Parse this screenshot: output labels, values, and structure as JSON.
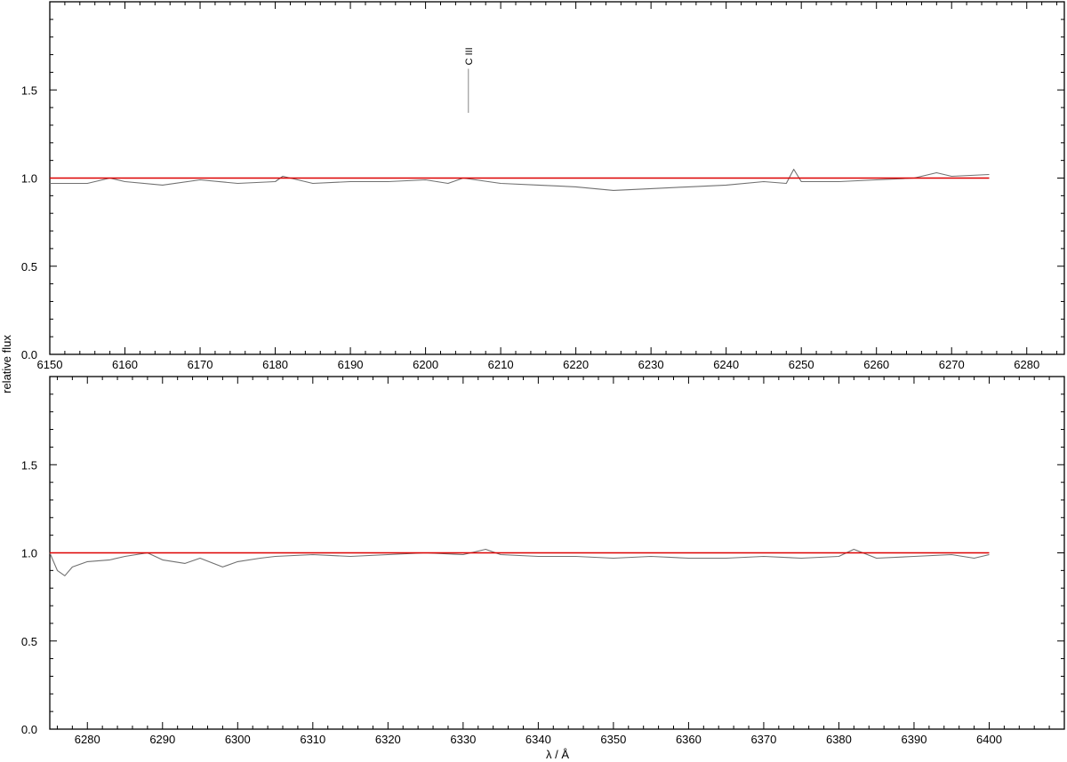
{
  "chart_data": {
    "type": "line",
    "ylabel": "relative flux",
    "xlabel": "λ / Å",
    "colors": {
      "observed": "#707070",
      "model": "#dd0000",
      "frame": "#000000"
    },
    "panels": [
      {
        "xlim": [
          6150,
          6285
        ],
        "ylim": [
          0.0,
          2.0
        ],
        "xticks": [
          6150,
          6160,
          6170,
          6180,
          6190,
          6200,
          6210,
          6220,
          6230,
          6240,
          6250,
          6260,
          6270,
          6280
        ],
        "yticks": [
          0.0,
          0.5,
          1.0,
          1.5
        ],
        "ytick_labels": [
          "0.0",
          "0.5",
          "1.0",
          "1.5"
        ],
        "annotations": [
          {
            "text": "C III",
            "x": 6205.7,
            "y_bottom": 1.37,
            "y_top": 1.62
          }
        ],
        "series": [
          {
            "role": "model",
            "x": [
              6150,
              6275
            ],
            "y": [
              1.0,
              1.0
            ]
          },
          {
            "role": "observed",
            "x": [
              6150,
              6155,
              6158,
              6160,
              6165,
              6170,
              6175,
              6180,
              6181,
              6185,
              6190,
              6195,
              6200,
              6203,
              6205,
              6210,
              6215,
              6220,
              6225,
              6230,
              6235,
              6240,
              6245,
              6248,
              6249,
              6250,
              6255,
              6260,
              6265,
              6268,
              6270,
              6275
            ],
            "y": [
              0.97,
              0.97,
              1.0,
              0.98,
              0.96,
              0.99,
              0.97,
              0.98,
              1.01,
              0.97,
              0.98,
              0.98,
              0.99,
              0.97,
              1.0,
              0.97,
              0.96,
              0.95,
              0.93,
              0.94,
              0.95,
              0.96,
              0.98,
              0.97,
              1.05,
              0.98,
              0.98,
              0.99,
              1.0,
              1.03,
              1.01,
              1.02
            ]
          }
        ]
      },
      {
        "xlim": [
          6275,
          6410
        ],
        "ylim": [
          0.0,
          2.0
        ],
        "xticks": [
          6280,
          6290,
          6300,
          6310,
          6320,
          6330,
          6340,
          6350,
          6360,
          6370,
          6380,
          6390,
          6400
        ],
        "yticks": [
          0.0,
          0.5,
          1.0,
          1.5
        ],
        "ytick_labels": [
          "0.0",
          "0.5",
          "1.0",
          "1.5"
        ],
        "annotations": [],
        "series": [
          {
            "role": "model",
            "x": [
              6275,
              6400
            ],
            "y": [
              1.0,
              1.0
            ]
          },
          {
            "role": "observed",
            "x": [
              6275,
              6276,
              6277,
              6278,
              6280,
              6283,
              6285,
              6288,
              6290,
              6293,
              6295,
              6298,
              6300,
              6303,
              6305,
              6310,
              6315,
              6320,
              6325,
              6330,
              6333,
              6335,
              6340,
              6345,
              6350,
              6355,
              6360,
              6365,
              6370,
              6375,
              6380,
              6382,
              6385,
              6390,
              6395,
              6398,
              6400
            ],
            "y": [
              1.0,
              0.9,
              0.87,
              0.92,
              0.95,
              0.96,
              0.98,
              1.0,
              0.96,
              0.94,
              0.97,
              0.92,
              0.95,
              0.97,
              0.98,
              0.99,
              0.98,
              0.99,
              1.0,
              0.99,
              1.02,
              0.99,
              0.98,
              0.98,
              0.97,
              0.98,
              0.97,
              0.97,
              0.98,
              0.97,
              0.98,
              1.02,
              0.97,
              0.98,
              0.99,
              0.97,
              0.99
            ]
          }
        ]
      }
    ]
  }
}
